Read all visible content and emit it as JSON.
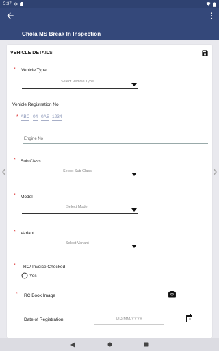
{
  "status_bar": {
    "time": "5:37"
  },
  "app_bar": {
    "title": "Chola MS Break In Inspection"
  },
  "card": {
    "title": "VEHICLE DETAILS",
    "vehicle_type": {
      "label": "Vehicle Type",
      "placeholder": "Select Vehicle Type"
    },
    "registration": {
      "label": "Vehicle Registration No",
      "seg1": "ABC",
      "seg2": "04",
      "seg3": "0AB",
      "seg4": "1234"
    },
    "engine_no": {
      "placeholder": "Engine No"
    },
    "sub_class": {
      "label": "Sub Class",
      "placeholder": "Select Sub Class"
    },
    "model": {
      "label": "Model",
      "placeholder": "Select Model"
    },
    "variant": {
      "label": "Variant",
      "placeholder": "Select Variant"
    },
    "rc_invoice": {
      "label": "RC/ Invoice Checked",
      "option_yes": "Yes"
    },
    "rc_book_image": {
      "label": "RC Book Image"
    },
    "registration_date": {
      "label": "Date of Registration",
      "placeholder": "DD/MM/YYYY"
    }
  },
  "required_marker": "*",
  "colors": {
    "primary": "#34487a",
    "status_bar": "#2f4271",
    "required": "#dd3333"
  },
  "icons": [
    "back-arrow-icon",
    "overflow-menu-icon",
    "save-icon",
    "camera-icon",
    "calendar-icon",
    "dropdown-arrow-icon",
    "radio-icon",
    "nav-back-icon",
    "nav-home-icon",
    "nav-recents-icon",
    "chevron-left-icon",
    "chevron-right-icon"
  ]
}
